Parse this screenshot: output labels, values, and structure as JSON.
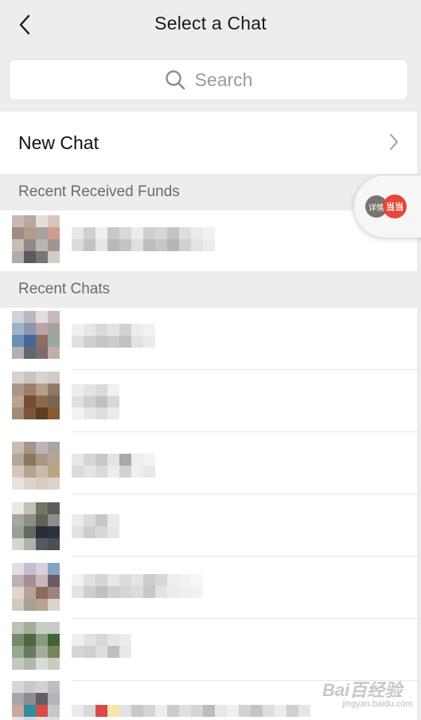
{
  "nav": {
    "title": "Select a Chat",
    "back_icon": "chevron-left-icon"
  },
  "search": {
    "placeholder": "Search",
    "icon": "search-icon"
  },
  "new_chat": {
    "label": "New Chat",
    "icon": "chevron-right-icon"
  },
  "sections": {
    "recent_funds": "Recent Received Funds",
    "recent_chats": "Recent Chats"
  },
  "floating_widget": {
    "left_badge": "详情",
    "right_badge": "当当"
  },
  "watermark": {
    "text": "Bai百经验",
    "sub": "jingyan.baidu.com"
  },
  "colors": {
    "background": "#ededed",
    "row": "#ffffff",
    "divider": "#e6e6e6",
    "secondary_text": "#6b6b6b"
  }
}
